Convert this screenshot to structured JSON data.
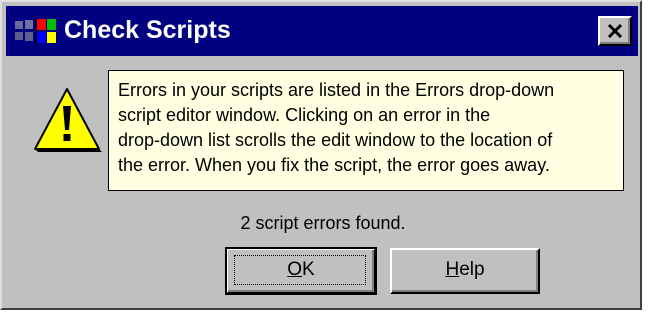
{
  "window": {
    "title": "Check Scripts",
    "close_symbol": "×"
  },
  "icons": {
    "app": "windows-flag-icon",
    "message": "warning-icon",
    "close": "close-icon"
  },
  "message": {
    "lines": [
      "Errors in your scripts are listed in the Errors drop-down",
      "script editor window.  Clicking on an error in the",
      "drop-down list scrolls the edit window to the location of",
      "the error.  When you fix the script, the error goes away."
    ]
  },
  "status": "2 script errors found.",
  "buttons": {
    "ok": {
      "mnemonic": "O",
      "rest": "K"
    },
    "help": {
      "mnemonic": "H",
      "rest": "elp"
    }
  },
  "colors": {
    "titlebar": "#000080",
    "dialog": "#c0c0c0",
    "tooltip": "#ffffe1",
    "warning": "#ffff00"
  }
}
